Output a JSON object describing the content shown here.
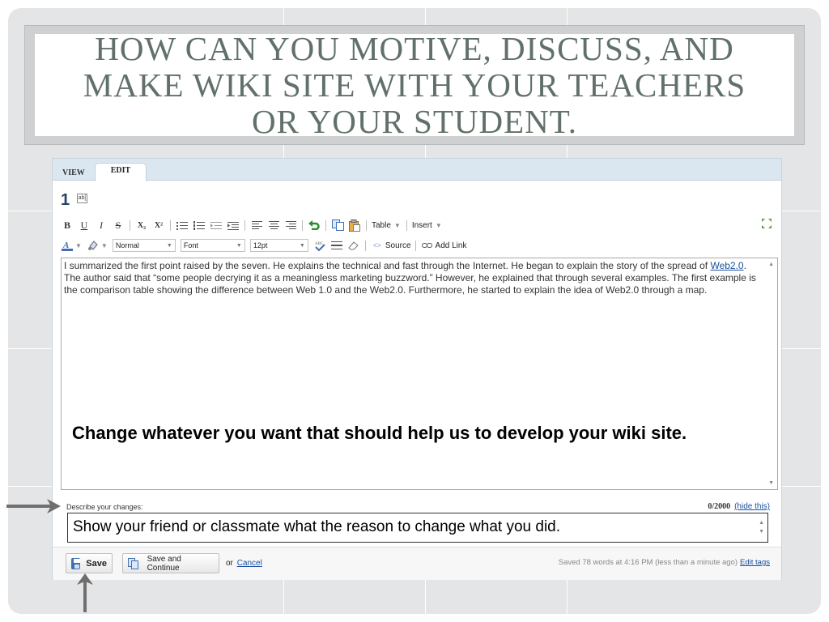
{
  "slide": {
    "title": "HOW CAN YOU MOTIVE, DISCUSS, AND MAKE WIKI SITE WITH YOUR TEACHERS OR YOUR STUDENT."
  },
  "wiki": {
    "tabs": [
      {
        "label": "VIEW",
        "active": false
      },
      {
        "label": "EDIT",
        "active": true
      }
    ],
    "page_number": "1",
    "rename_icon_text": "ab[",
    "toolbar": {
      "bold": "B",
      "underline": "U",
      "italic": "I",
      "strike": "S",
      "subscript": "X₂",
      "superscript": "X²",
      "table_label": "Table",
      "insert_label": "Insert",
      "style_value": "Normal",
      "font_value": "Font",
      "size_value": "12pt",
      "source_label": "Source",
      "add_link_label": "Add Link",
      "icon_color": "#3f6fb3"
    },
    "editor": {
      "text_before": "I summarized the first point raised by the seven. He explains the technical and fast through the Internet. He began to explain the story of the spread of ",
      "link_text": "Web2.0",
      "text_after": ". The author said that “some people decrying it as a meaningless marketing buzzword.” However, he explained that through several examples. The first example is the comparison table showing the difference between Web 1.0 and the Web2.0. Furthermore, he started to explain the idea of Web2.0 through a map.",
      "overlay_note": "Change whatever you want that should help us to develop your wiki site."
    },
    "describe": {
      "label": "Describe your changes:",
      "count": "0/2000",
      "hide_link": "(hide this)",
      "value": "Show your friend or classmate what the reason to change what you did."
    },
    "footer": {
      "save_label": "Save",
      "save_continue_label": "Save and Continue",
      "or_text": "or",
      "cancel_link": "Cancel",
      "saved_text": "Saved 78 words at 4:16 PM (less than a minute ago)",
      "edit_tags_link": "Edit tags"
    }
  }
}
